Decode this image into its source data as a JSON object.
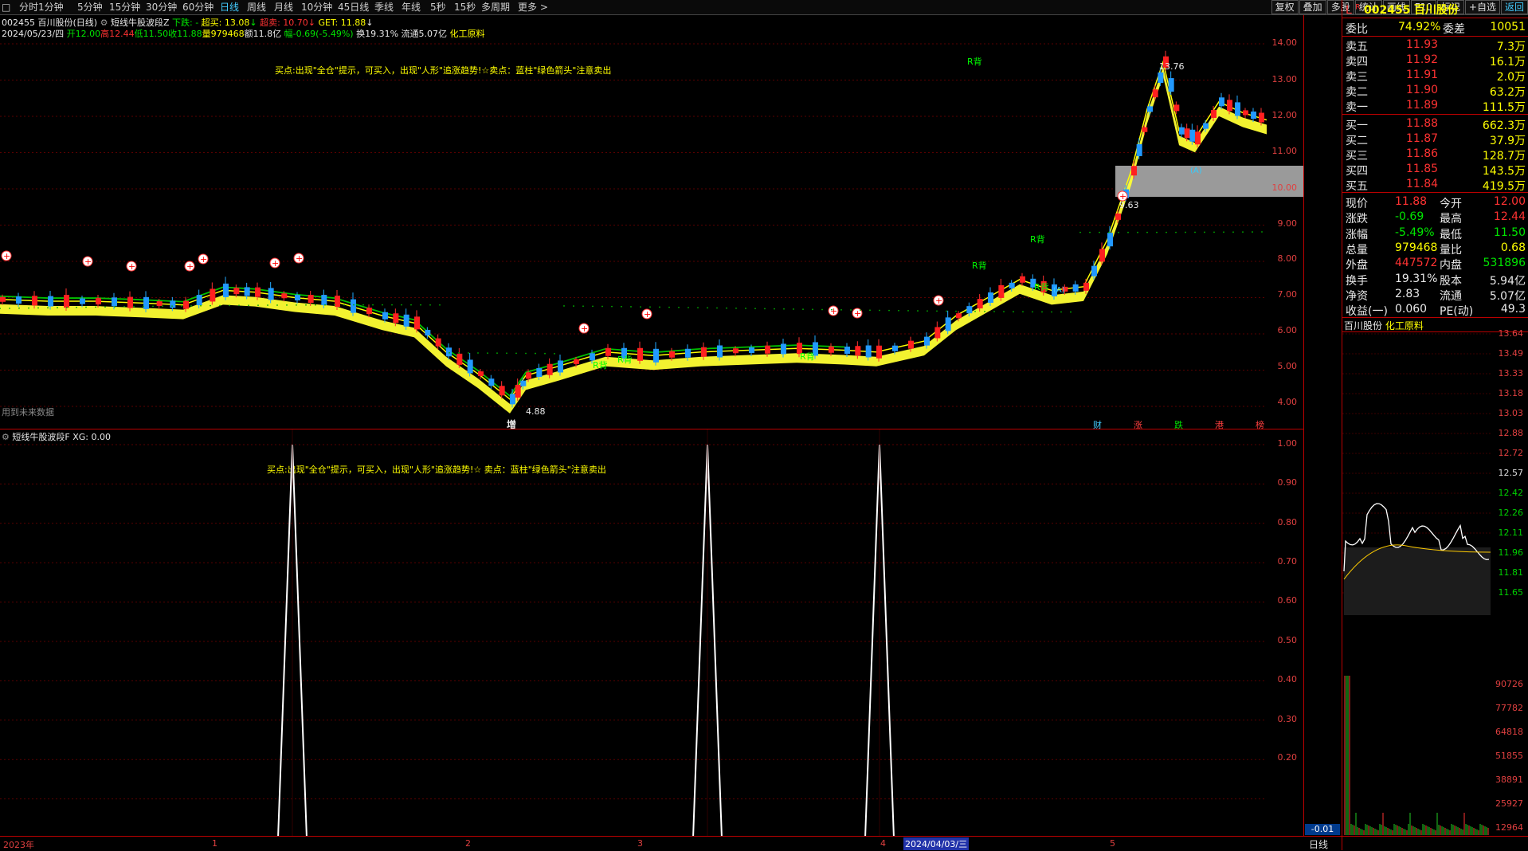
{
  "toolbar": {
    "periods": [
      "分时",
      "1分钟",
      "5分钟",
      "15分钟",
      "30分钟",
      "60分钟",
      "日线",
      "周线",
      "月线",
      "10分钟",
      "45日线",
      "季线",
      "年线",
      "5秒",
      "15秒",
      "多周期",
      "更多 >"
    ],
    "active_period": "日线",
    "right_buttons": [
      "复权",
      "叠加",
      "多股",
      "统计",
      "画线",
      "F10",
      "标记",
      "+自选",
      "返回"
    ]
  },
  "main_chart": {
    "header_line1": {
      "stock": "002455 百川股份(日线)",
      "indicator": "短线牛股波段Z",
      "down_label": "下跌: -",
      "buy_label": "超买: 13.08",
      "sell_label": "超卖: 10.70",
      "get_label": "GET: 11.88"
    },
    "header_line2": {
      "date": "2024/05/23/四",
      "open": "开12.00",
      "high": "高12.44",
      "low": "低11.50",
      "close": "收11.88",
      "volume": "量979468",
      "amount": "额11.8亿",
      "change": "幅-0.69(-5.49%)",
      "turnover": "换19.31%",
      "float": "流通5.07亿",
      "sector": "化工原料"
    },
    "banner": "买点:出现\"全仓\"提示，可买入，出现\"人形\"追涨趋势!☆卖点：蓝柱\"绿色箭头\"注意卖出",
    "future_note": "用到未来数据",
    "y_labels": [
      "14.00",
      "13.00",
      "12.00",
      "11.00",
      "10.00",
      "9.00",
      "8.00",
      "7.00",
      "6.00",
      "5.00",
      "4.00"
    ],
    "annotations": [
      "13.76",
      "9.63",
      "4.88",
      "增"
    ],
    "bottom_tags": [
      "财",
      "涨",
      "跌",
      "港",
      "榜"
    ],
    "markers": [
      "R背",
      "R背",
      "R背",
      "R背",
      "R背",
      "R背",
      "R背",
      "(A)",
      "(A)"
    ]
  },
  "lower_chart": {
    "header": "短线牛股波段F  XG: 0.00",
    "banner": "买点:出现\"全仓\"提示，可买入，出现\"人形\"追涨趋势!☆  卖点：蓝柱\"绿色箭头\"注意卖出",
    "y_labels": [
      "1.00",
      "0.90",
      "0.80",
      "0.70",
      "0.60",
      "0.50",
      "0.40",
      "0.30",
      "0.20"
    ],
    "bottom_value": "-0.01",
    "spikes": [
      1,
      1,
      1
    ]
  },
  "x_axis": {
    "labels": [
      "2023年",
      "1",
      "2",
      "3",
      "4",
      "2024/04/03/三",
      "5"
    ]
  },
  "side": {
    "header_l": "L",
    "header_r": "R",
    "code": "002455",
    "name": "百川股份",
    "weibi_label": "委比",
    "weibi_value": "74.92%",
    "weicha_label": "委差",
    "weicha_value": "10051",
    "asks": [
      {
        "label": "卖五",
        "price": "11.93",
        "vol": "7.3万"
      },
      {
        "label": "卖四",
        "price": "11.92",
        "vol": "16.1万"
      },
      {
        "label": "卖三",
        "price": "11.91",
        "vol": "2.0万"
      },
      {
        "label": "卖二",
        "price": "11.90",
        "vol": "63.2万"
      },
      {
        "label": "卖一",
        "price": "11.89",
        "vol": "111.5万"
      }
    ],
    "bids": [
      {
        "label": "买一",
        "price": "11.88",
        "vol": "662.3万"
      },
      {
        "label": "买二",
        "price": "11.87",
        "vol": "37.9万"
      },
      {
        "label": "买三",
        "price": "11.86",
        "vol": "128.7万"
      },
      {
        "label": "买四",
        "price": "11.85",
        "vol": "143.5万"
      },
      {
        "label": "买五",
        "price": "11.84",
        "vol": "419.5万"
      }
    ],
    "stats": [
      {
        "l1": "现价",
        "v1": "11.88",
        "l2": "今开",
        "v2": "12.00",
        "c1": "red",
        "c2": "red"
      },
      {
        "l1": "涨跌",
        "v1": "-0.69",
        "l2": "最高",
        "v2": "12.44",
        "c1": "green",
        "c2": "red"
      },
      {
        "l1": "涨幅",
        "v1": "-5.49%",
        "l2": "最低",
        "v2": "11.50",
        "c1": "green",
        "c2": "green"
      },
      {
        "l1": "总量",
        "v1": "979468",
        "l2": "量比",
        "v2": "0.68",
        "c1": "yellow",
        "c2": "yellow"
      },
      {
        "l1": "外盘",
        "v1": "447572",
        "l2": "内盘",
        "v2": "531896",
        "c1": "red",
        "c2": "green"
      },
      {
        "l1": "换手",
        "v1": "19.31%",
        "l2": "股本",
        "v2": "5.94亿",
        "c1": "white",
        "c2": "white"
      },
      {
        "l1": "净资",
        "v1": "2.83",
        "l2": "流通",
        "v2": "5.07亿",
        "c1": "white",
        "c2": "white"
      },
      {
        "l1": "收益(一)",
        "v1": "0.060",
        "l2": "PE(动)",
        "v2": "49.3",
        "c1": "white",
        "c2": "white"
      }
    ],
    "mini_title": "百川股份",
    "mini_sector": "化工原料",
    "mini_y": [
      "13.64",
      "13.49",
      "13.33",
      "13.18",
      "13.03",
      "12.88",
      "12.72",
      "12.57",
      "12.42",
      "12.26",
      "12.11",
      "11.96",
      "11.81",
      "11.65"
    ],
    "mini_vol": [
      "90726",
      "77782",
      "64818",
      "51855",
      "38891",
      "25927",
      "12964"
    ],
    "bottom_tab": "日线"
  }
}
